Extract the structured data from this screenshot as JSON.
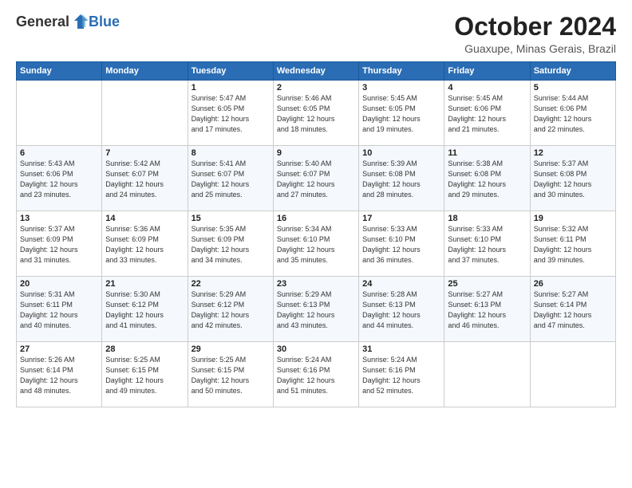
{
  "logo": {
    "general": "General",
    "blue": "Blue"
  },
  "title": "October 2024",
  "subtitle": "Guaxupe, Minas Gerais, Brazil",
  "days_header": [
    "Sunday",
    "Monday",
    "Tuesday",
    "Wednesday",
    "Thursday",
    "Friday",
    "Saturday"
  ],
  "weeks": [
    [
      {
        "day": "",
        "info": ""
      },
      {
        "day": "",
        "info": ""
      },
      {
        "day": "1",
        "info": "Sunrise: 5:47 AM\nSunset: 6:05 PM\nDaylight: 12 hours\nand 17 minutes."
      },
      {
        "day": "2",
        "info": "Sunrise: 5:46 AM\nSunset: 6:05 PM\nDaylight: 12 hours\nand 18 minutes."
      },
      {
        "day": "3",
        "info": "Sunrise: 5:45 AM\nSunset: 6:05 PM\nDaylight: 12 hours\nand 19 minutes."
      },
      {
        "day": "4",
        "info": "Sunrise: 5:45 AM\nSunset: 6:06 PM\nDaylight: 12 hours\nand 21 minutes."
      },
      {
        "day": "5",
        "info": "Sunrise: 5:44 AM\nSunset: 6:06 PM\nDaylight: 12 hours\nand 22 minutes."
      }
    ],
    [
      {
        "day": "6",
        "info": "Sunrise: 5:43 AM\nSunset: 6:06 PM\nDaylight: 12 hours\nand 23 minutes."
      },
      {
        "day": "7",
        "info": "Sunrise: 5:42 AM\nSunset: 6:07 PM\nDaylight: 12 hours\nand 24 minutes."
      },
      {
        "day": "8",
        "info": "Sunrise: 5:41 AM\nSunset: 6:07 PM\nDaylight: 12 hours\nand 25 minutes."
      },
      {
        "day": "9",
        "info": "Sunrise: 5:40 AM\nSunset: 6:07 PM\nDaylight: 12 hours\nand 27 minutes."
      },
      {
        "day": "10",
        "info": "Sunrise: 5:39 AM\nSunset: 6:08 PM\nDaylight: 12 hours\nand 28 minutes."
      },
      {
        "day": "11",
        "info": "Sunrise: 5:38 AM\nSunset: 6:08 PM\nDaylight: 12 hours\nand 29 minutes."
      },
      {
        "day": "12",
        "info": "Sunrise: 5:37 AM\nSunset: 6:08 PM\nDaylight: 12 hours\nand 30 minutes."
      }
    ],
    [
      {
        "day": "13",
        "info": "Sunrise: 5:37 AM\nSunset: 6:09 PM\nDaylight: 12 hours\nand 31 minutes."
      },
      {
        "day": "14",
        "info": "Sunrise: 5:36 AM\nSunset: 6:09 PM\nDaylight: 12 hours\nand 33 minutes."
      },
      {
        "day": "15",
        "info": "Sunrise: 5:35 AM\nSunset: 6:09 PM\nDaylight: 12 hours\nand 34 minutes."
      },
      {
        "day": "16",
        "info": "Sunrise: 5:34 AM\nSunset: 6:10 PM\nDaylight: 12 hours\nand 35 minutes."
      },
      {
        "day": "17",
        "info": "Sunrise: 5:33 AM\nSunset: 6:10 PM\nDaylight: 12 hours\nand 36 minutes."
      },
      {
        "day": "18",
        "info": "Sunrise: 5:33 AM\nSunset: 6:10 PM\nDaylight: 12 hours\nand 37 minutes."
      },
      {
        "day": "19",
        "info": "Sunrise: 5:32 AM\nSunset: 6:11 PM\nDaylight: 12 hours\nand 39 minutes."
      }
    ],
    [
      {
        "day": "20",
        "info": "Sunrise: 5:31 AM\nSunset: 6:11 PM\nDaylight: 12 hours\nand 40 minutes."
      },
      {
        "day": "21",
        "info": "Sunrise: 5:30 AM\nSunset: 6:12 PM\nDaylight: 12 hours\nand 41 minutes."
      },
      {
        "day": "22",
        "info": "Sunrise: 5:29 AM\nSunset: 6:12 PM\nDaylight: 12 hours\nand 42 minutes."
      },
      {
        "day": "23",
        "info": "Sunrise: 5:29 AM\nSunset: 6:13 PM\nDaylight: 12 hours\nand 43 minutes."
      },
      {
        "day": "24",
        "info": "Sunrise: 5:28 AM\nSunset: 6:13 PM\nDaylight: 12 hours\nand 44 minutes."
      },
      {
        "day": "25",
        "info": "Sunrise: 5:27 AM\nSunset: 6:13 PM\nDaylight: 12 hours\nand 46 minutes."
      },
      {
        "day": "26",
        "info": "Sunrise: 5:27 AM\nSunset: 6:14 PM\nDaylight: 12 hours\nand 47 minutes."
      }
    ],
    [
      {
        "day": "27",
        "info": "Sunrise: 5:26 AM\nSunset: 6:14 PM\nDaylight: 12 hours\nand 48 minutes."
      },
      {
        "day": "28",
        "info": "Sunrise: 5:25 AM\nSunset: 6:15 PM\nDaylight: 12 hours\nand 49 minutes."
      },
      {
        "day": "29",
        "info": "Sunrise: 5:25 AM\nSunset: 6:15 PM\nDaylight: 12 hours\nand 50 minutes."
      },
      {
        "day": "30",
        "info": "Sunrise: 5:24 AM\nSunset: 6:16 PM\nDaylight: 12 hours\nand 51 minutes."
      },
      {
        "day": "31",
        "info": "Sunrise: 5:24 AM\nSunset: 6:16 PM\nDaylight: 12 hours\nand 52 minutes."
      },
      {
        "day": "",
        "info": ""
      },
      {
        "day": "",
        "info": ""
      }
    ]
  ]
}
